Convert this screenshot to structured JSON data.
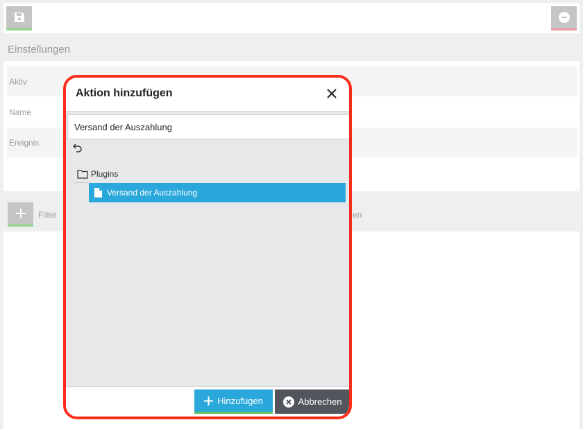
{
  "toolbar": {
    "save_icon": "floppy-disk-icon",
    "remove_icon": "minus-circle-icon"
  },
  "settings": {
    "title": "Einstellungen",
    "fields": [
      {
        "label": "Aktiv"
      },
      {
        "label": "Name"
      },
      {
        "label": "Ereignis"
      }
    ]
  },
  "filter": {
    "label": "Filter",
    "partial_text": "en"
  },
  "dialog": {
    "title": "Aktion hinzufügen",
    "search_value": "Versand der Auszahlung",
    "tree": {
      "folder": "Plugins",
      "selected_item": "Versand der Auszahlung"
    },
    "add_button": "Hinzufügen",
    "cancel_button": "Abbrechen",
    "accent_color": "#2aa8db",
    "highlight_color": "#ff2a1a"
  }
}
